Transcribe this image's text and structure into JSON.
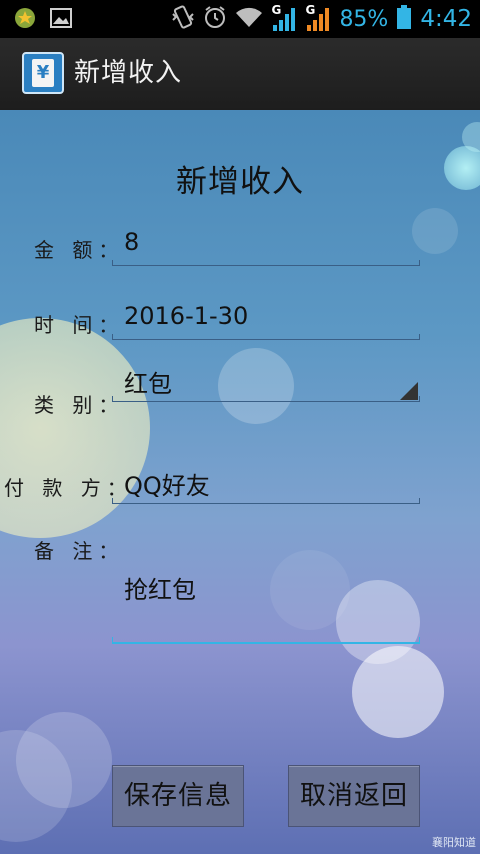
{
  "status_bar": {
    "signal_label_1": "G",
    "signal_label_2": "G",
    "battery": "85%",
    "time": "4:42"
  },
  "action_bar": {
    "app_icon_glyph": "¥",
    "title": "新增收入"
  },
  "form": {
    "title": "新增收入",
    "amount": {
      "label": "金 额：",
      "value": "8"
    },
    "time": {
      "label": "时 间：",
      "value": "2016-1-30"
    },
    "category": {
      "label": "类 别：",
      "value": "红包"
    },
    "payer": {
      "label": "付 款 方：",
      "value": "QQ好友"
    },
    "note": {
      "label": "备 注：",
      "value": "抢红包"
    }
  },
  "buttons": {
    "save": "保存信息",
    "cancel": "取消返回"
  },
  "watermark": "襄阳知道",
  "colors": {
    "accent": "#33b5e5",
    "action_bar": "#222222"
  }
}
